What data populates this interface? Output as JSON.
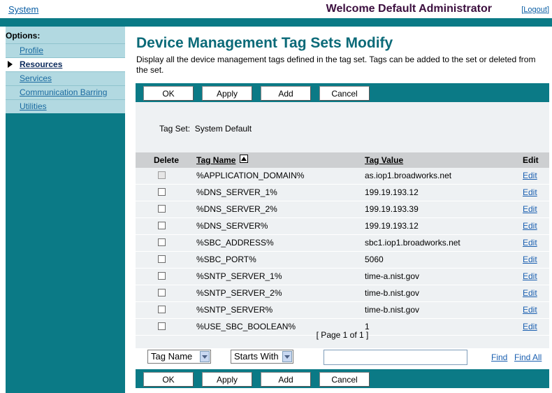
{
  "header": {
    "system_link": "System",
    "welcome": "Welcome Default Administrator",
    "logout": "Logout"
  },
  "sidebar": {
    "options_label": "Options:",
    "items": [
      {
        "label": "Profile",
        "active": false
      },
      {
        "label": "Resources",
        "active": true
      },
      {
        "label": "Services",
        "active": false
      },
      {
        "label": "Communication Barring",
        "active": false
      },
      {
        "label": "Utilities",
        "active": false
      }
    ]
  },
  "main": {
    "title": "Device Management Tag Sets Modify",
    "description": "Display all the device management tags defined in the tag set. Tags can be added to the set or deleted from the set.",
    "buttons": {
      "ok": "OK",
      "apply": "Apply",
      "add": "Add",
      "cancel": "Cancel"
    },
    "tag_set_label": "Tag Set:  System Default",
    "table": {
      "headers": {
        "delete": "Delete",
        "tag_name": "Tag Name",
        "tag_value": "Tag Value",
        "edit": "Edit"
      },
      "sort_icon": "sort-ascending-icon",
      "rows": [
        {
          "tag_name": "%APPLICATION_DOMAIN%",
          "tag_value": "as.iop1.broadworks.net",
          "edit": "Edit",
          "checkbox_disabled": true
        },
        {
          "tag_name": "%DNS_SERVER_1%",
          "tag_value": "199.19.193.12",
          "edit": "Edit",
          "checkbox_disabled": false
        },
        {
          "tag_name": "%DNS_SERVER_2%",
          "tag_value": "199.19.193.39",
          "edit": "Edit",
          "checkbox_disabled": false
        },
        {
          "tag_name": "%DNS_SERVER%",
          "tag_value": "199.19.193.12",
          "edit": "Edit",
          "checkbox_disabled": false
        },
        {
          "tag_name": "%SBC_ADDRESS%",
          "tag_value": "sbc1.iop1.broadworks.net",
          "edit": "Edit",
          "checkbox_disabled": false
        },
        {
          "tag_name": "%SBC_PORT%",
          "tag_value": "5060",
          "edit": "Edit",
          "checkbox_disabled": false
        },
        {
          "tag_name": "%SNTP_SERVER_1%",
          "tag_value": "time-a.nist.gov",
          "edit": "Edit",
          "checkbox_disabled": false
        },
        {
          "tag_name": "%SNTP_SERVER_2%",
          "tag_value": "time-b.nist.gov",
          "edit": "Edit",
          "checkbox_disabled": false
        },
        {
          "tag_name": "%SNTP_SERVER%",
          "tag_value": "time-b.nist.gov",
          "edit": "Edit",
          "checkbox_disabled": false
        },
        {
          "tag_name": "%USE_SBC_BOOLEAN%",
          "tag_value": "1",
          "edit": "Edit",
          "checkbox_disabled": false
        }
      ]
    },
    "pager": "[ Page 1 of 1 ]",
    "search": {
      "field_select": "Tag Name",
      "mode_select": "Starts With",
      "input_value": "",
      "find": "Find",
      "find_all": "Find All"
    }
  },
  "colors": {
    "teal": "#0b7a86",
    "sidebar_light": "#b2d9e1",
    "title": "#0b6a78",
    "link": "#1a5fb0"
  }
}
